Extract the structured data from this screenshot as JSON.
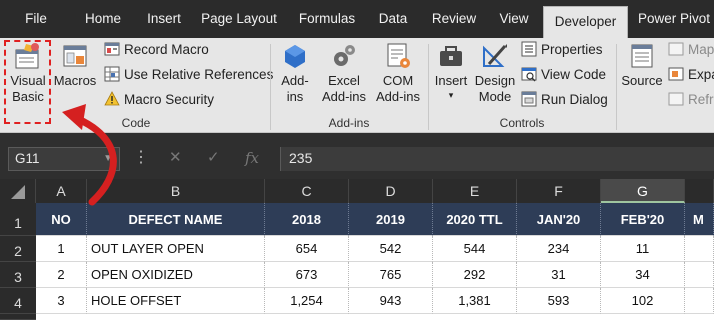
{
  "ribbon_tabs": [
    "File",
    "Home",
    "Insert",
    "Page Layout",
    "Formulas",
    "Data",
    "Review",
    "View",
    "Developer",
    "Power Pivot"
  ],
  "active_tab": "Developer",
  "groups": {
    "code": {
      "label": "Code",
      "visual_basic": "Visual\nBasic",
      "macros": "Macros",
      "record_macro": "Record Macro",
      "relative_refs": "Use Relative References",
      "macro_security": "Macro Security"
    },
    "addins": {
      "label": "Add-ins",
      "addins": "Add-\nins",
      "excel_addins": "Excel\nAdd-ins",
      "com_addins": "COM\nAdd-ins"
    },
    "controls": {
      "label": "Controls",
      "insert": "Insert",
      "design_mode": "Design\nMode",
      "properties": "Properties",
      "view_code": "View Code",
      "run_dialog": "Run Dialog"
    },
    "xml": {
      "source": "Source",
      "map": "Map",
      "expand": "Expa",
      "refresh": "Refr"
    }
  },
  "formula_bar": {
    "name_box": "G11",
    "fx": "fx",
    "value": "235"
  },
  "columns": [
    "A",
    "B",
    "C",
    "D",
    "E",
    "F",
    "G"
  ],
  "selected_column": "G",
  "rows": [
    "1",
    "2",
    "3",
    "4"
  ],
  "table": {
    "headers": [
      "NO",
      "DEFECT NAME",
      "2018",
      "2019",
      "2020 TTL",
      "JAN'20",
      "FEB'20",
      "M"
    ],
    "rows": [
      [
        "1",
        "OUT LAYER OPEN",
        "654",
        "542",
        "544",
        "234",
        "11"
      ],
      [
        "2",
        "OPEN OXIDIZED",
        "673",
        "765",
        "292",
        "31",
        "34"
      ],
      [
        "3",
        "HOLE OFFSET",
        "1,254",
        "943",
        "1,381",
        "593",
        "102"
      ]
    ]
  },
  "colors": {
    "tabbar": "#2b2b2b",
    "ribbon": "#e6e6e6",
    "header_fill": "#2e3d57",
    "highlight": "#e02020"
  }
}
